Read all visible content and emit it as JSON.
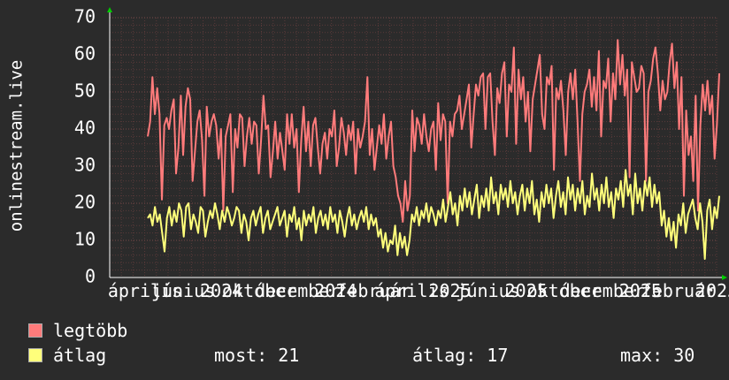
{
  "chart_data": {
    "type": "line",
    "ylabel": "onlinestream.live",
    "ylim": [
      0,
      70
    ],
    "yticks": [
      "0",
      "10",
      "20",
      "30",
      "40",
      "50",
      "60",
      "70"
    ],
    "xtick_labels": [
      "április",
      "június",
      "2024",
      "október",
      "december",
      "2024",
      "február",
      "április",
      "2025",
      "június",
      "2025",
      "október",
      "december",
      "2025",
      "február",
      "2025"
    ],
    "x_range": [
      "2024-03-25",
      "2026-03-15"
    ],
    "grid": true,
    "series": [
      {
        "name": "legtöbb",
        "color": "#ff7b7b",
        "values": [
          38,
          42,
          54,
          44,
          51,
          44,
          21,
          41,
          43,
          40,
          45,
          48,
          28,
          35,
          49,
          33,
          46,
          51,
          48,
          26,
          34,
          42,
          45,
          37,
          22,
          46,
          38,
          42,
          44,
          41,
          32,
          40,
          18,
          38,
          41,
          44,
          23,
          40,
          35,
          44,
          43,
          30,
          38,
          43,
          36,
          42,
          41,
          28,
          37,
          49,
          40,
          41,
          27,
          34,
          42,
          32,
          39,
          34,
          29,
          44,
          36,
          44,
          35,
          40,
          23,
          37,
          46,
          34,
          42,
          30,
          41,
          43,
          35,
          28,
          36,
          39,
          32,
          40,
          38,
          45,
          30,
          35,
          43,
          39,
          33,
          41,
          37,
          42,
          28,
          40,
          35,
          38,
          42,
          54,
          33,
          40,
          29,
          35,
          41,
          36,
          44,
          32,
          38,
          42,
          30,
          27,
          22,
          20,
          15,
          26,
          18,
          22,
          45,
          34,
          43,
          41,
          36,
          44,
          38,
          34,
          40,
          42,
          29,
          47,
          37,
          44,
          42,
          20,
          42,
          38,
          44,
          45,
          49,
          40,
          44,
          48,
          52,
          35,
          44,
          52,
          49,
          54,
          55,
          40,
          54,
          55,
          42,
          33,
          51,
          47,
          55,
          58,
          38,
          52,
          50,
          62,
          36,
          56,
          48,
          54,
          42,
          50,
          34,
          48,
          52,
          56,
          60,
          44,
          40,
          54,
          52,
          57,
          29,
          51,
          48,
          53,
          45,
          33,
          50,
          55,
          48,
          56,
          42,
          26,
          44,
          50,
          52,
          56,
          46,
          54,
          45,
          61,
          38,
          53,
          51,
          59,
          42,
          55,
          48,
          64,
          52,
          60,
          49,
          56,
          27,
          58,
          54,
          50,
          51,
          57,
          55,
          26,
          50,
          53,
          59,
          62,
          55,
          45,
          53,
          48,
          50,
          58,
          63,
          51,
          58,
          40,
          54,
          22,
          45,
          33,
          38,
          26,
          49,
          18,
          41,
          52,
          45,
          53,
          44,
          49,
          32,
          41,
          55
        ]
      },
      {
        "name": "átlag",
        "color": "#ffff7b",
        "values": [
          16,
          17,
          14,
          19,
          15,
          17,
          12,
          7,
          16,
          19,
          14,
          18,
          15,
          20,
          18,
          11,
          19,
          20,
          13,
          17,
          15,
          12,
          19,
          18,
          11,
          15,
          18,
          16,
          20,
          17,
          13,
          18,
          15,
          19,
          17,
          14,
          16,
          19,
          18,
          12,
          17,
          15,
          10,
          16,
          18,
          14,
          17,
          19,
          12,
          16,
          18,
          13,
          15,
          17,
          19,
          14,
          16,
          18,
          11,
          17,
          15,
          19,
          13,
          16,
          10,
          18,
          14,
          17,
          15,
          19,
          12,
          16,
          18,
          14,
          17,
          13,
          19,
          15,
          17,
          12,
          18,
          15,
          11,
          16,
          19,
          14,
          17,
          13,
          16,
          18,
          15,
          19,
          13,
          17,
          14,
          16,
          11,
          13,
          8,
          12,
          7,
          10,
          9,
          14,
          6,
          12,
          8,
          11,
          6,
          10,
          17,
          15,
          19,
          14,
          18,
          16,
          20,
          15,
          19,
          17,
          14,
          18,
          16,
          21,
          15,
          19,
          23,
          17,
          20,
          14,
          22,
          18,
          24,
          19,
          23,
          17,
          21,
          25,
          16,
          22,
          19,
          24,
          18,
          27,
          20,
          23,
          17,
          25,
          21,
          24,
          19,
          26,
          20,
          23,
          17,
          22,
          25,
          18,
          24,
          20,
          26,
          17,
          21,
          15,
          23,
          19,
          25,
          20,
          24,
          16,
          22,
          26,
          19,
          23,
          17,
          27,
          21,
          25,
          18,
          24,
          20,
          26,
          17,
          22,
          19,
          28,
          21,
          24,
          18,
          25,
          20,
          27,
          19,
          23,
          16,
          24,
          21,
          26,
          19,
          29,
          22,
          25,
          17,
          28,
          20,
          24,
          18,
          26,
          22,
          27,
          19,
          25,
          20,
          23,
          14,
          18,
          11,
          16,
          10,
          15,
          8,
          17,
          14,
          20,
          12,
          17,
          19,
          21,
          16,
          13,
          20,
          15,
          5,
          18,
          21,
          13,
          19,
          16,
          22
        ]
      }
    ]
  },
  "legend": [
    {
      "label": "legtöbb",
      "color": "#ff7b7b"
    },
    {
      "label": "átlag",
      "color": "#ffff7b"
    }
  ],
  "stats": {
    "current": "most: 21",
    "average": "átlag: 17",
    "max": "max: 30"
  },
  "colors": {
    "background": "#2b2b2b",
    "plot_background": "#2b2b2b",
    "grid_minor": "#5a3a3a",
    "grid_major": "#7a4a4a",
    "axis": "#ffffff",
    "arrow": "#00cc00"
  }
}
